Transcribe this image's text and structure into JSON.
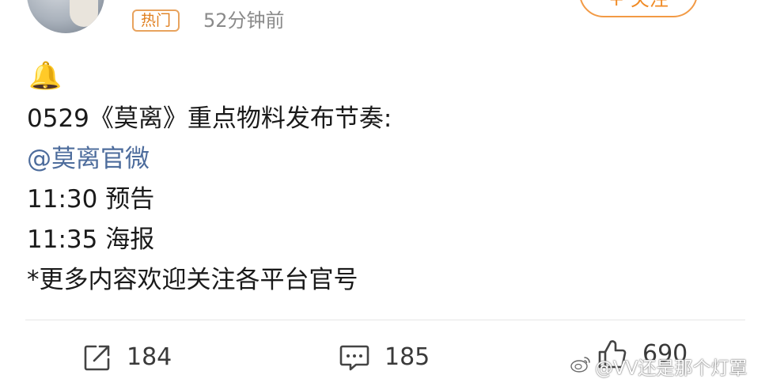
{
  "header": {
    "hot_badge": "热门",
    "time": "52分钟前",
    "follow_label": "+ 关注"
  },
  "post": {
    "bell_icon": "🔔",
    "line1": "0529《莫离》重点物料发布节奏:",
    "mention": "@莫离官微",
    "line3": "11:30 预告",
    "line4": "11:35 海报",
    "line5": "*更多内容欢迎关注各平台官号"
  },
  "actions": {
    "share_count": "184",
    "comment_count": "185",
    "like_count": "690"
  },
  "watermark": {
    "text": "@VV还是那个灯罩"
  },
  "icons": {
    "share": "share-icon",
    "comment": "comment-icon",
    "like": "like-icon",
    "weibo": "weibo-logo-icon"
  },
  "colors": {
    "hot_badge": "#e07f1f",
    "mention": "#4d6c9c",
    "follow": "#f08a24"
  }
}
